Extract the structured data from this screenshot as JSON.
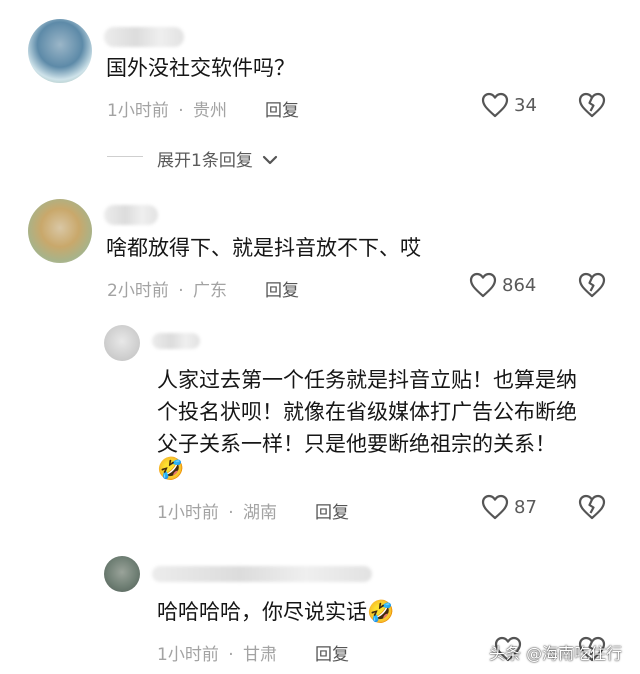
{
  "comments": [
    {
      "text": "国外没社交软件吗？",
      "time": "1小时前",
      "sep": "·",
      "location": "贵州",
      "reply_label": "回复",
      "likes": "34",
      "expand_label": "展开1条回复"
    },
    {
      "text": "啥都放得下、就是抖音放不下、哎",
      "time": "2小时前",
      "sep": "·",
      "location": "广东",
      "reply_label": "回复",
      "likes": "864"
    }
  ],
  "replies": [
    {
      "lines": [
        "人家过去第一个任务就是抖音立贴！也算是纳",
        "个投名状呗！就像在省级媒体打广告公布断绝",
        "父子关系一样！只是他要断绝祖宗的关系！"
      ],
      "emoji": "🤣",
      "time": "1小时前",
      "sep": "·",
      "location": "湖南",
      "reply_label": "回复",
      "likes": "87"
    },
    {
      "text": "哈哈哈哈，你尽说实话",
      "emoji": "🤣",
      "time": "1小时前",
      "sep": "·",
      "location": "甘肃",
      "reply_label": "回复"
    }
  ],
  "watermark": "头条 @海南吃住行",
  "icons": {
    "like": "heart-outline-icon",
    "dislike": "broken-heart-icon",
    "expand": "chevron-down-icon"
  },
  "colors": {
    "text": "#161616",
    "meta": "#a3a3a3",
    "icon": "#555555"
  }
}
